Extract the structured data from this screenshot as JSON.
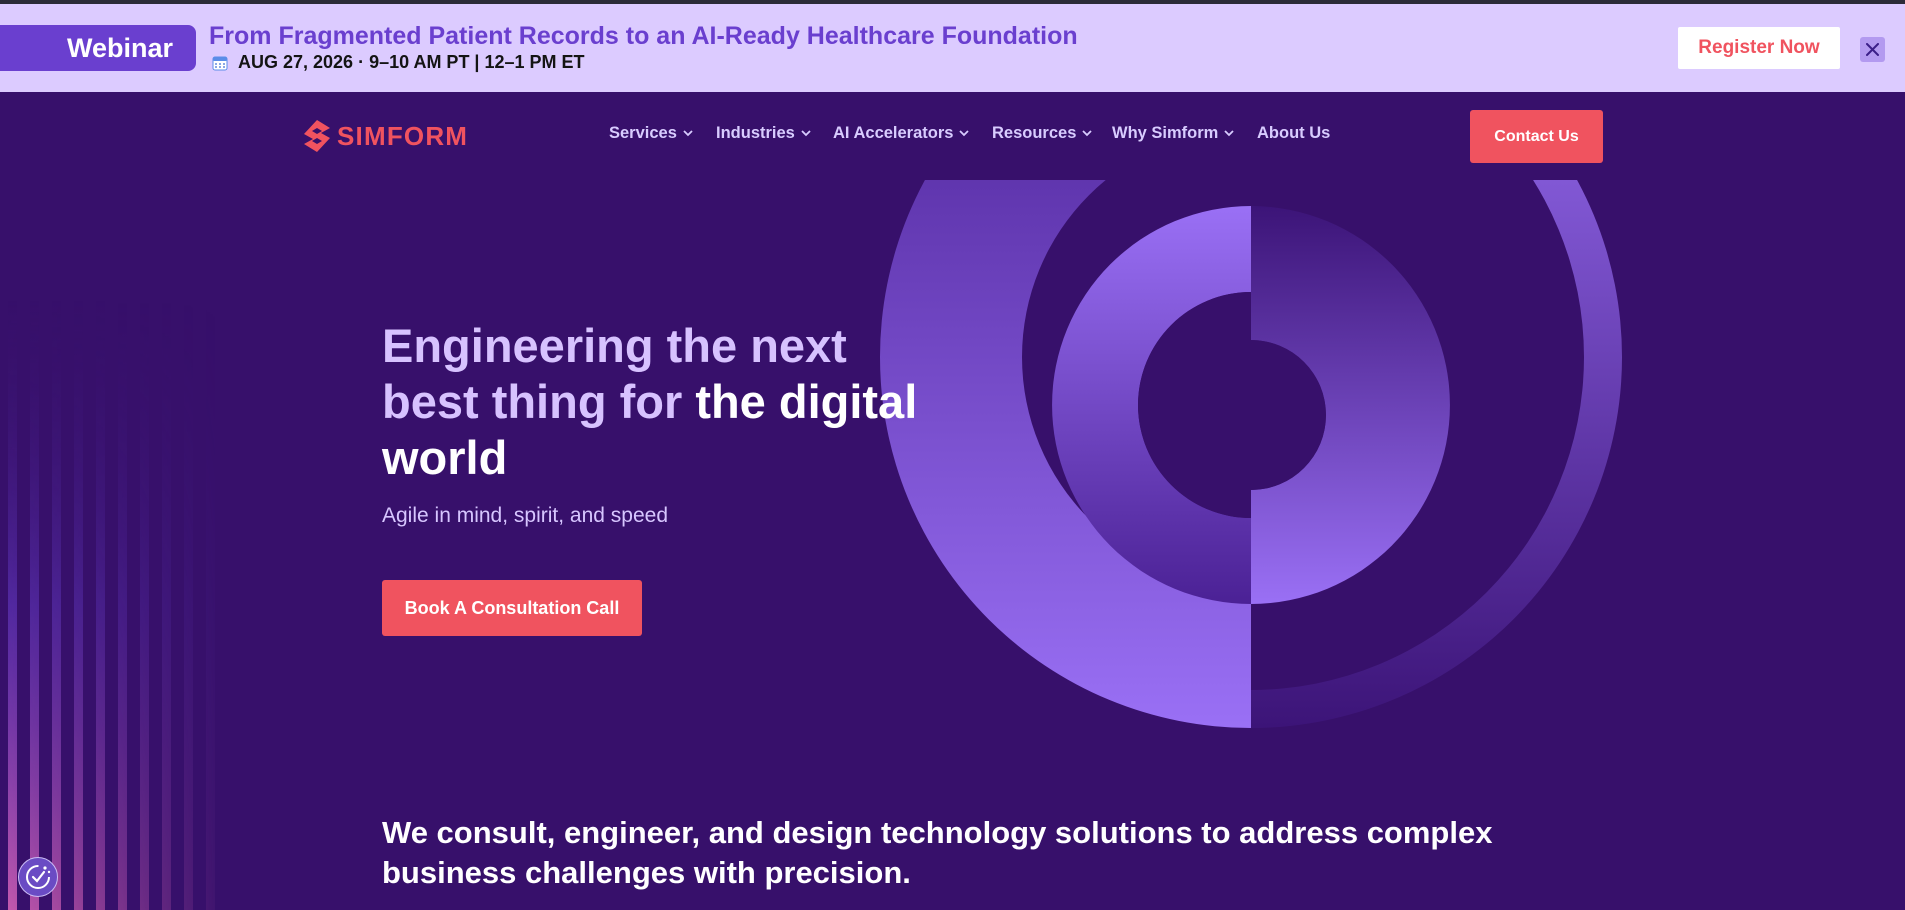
{
  "announcement": {
    "badge": "Webinar",
    "title": "From Fragmented Patient Records to an AI-Ready Healthcare Foundation",
    "date": "AUG 27, 2026 · 9–10 AM PT | 12–1 PM ET",
    "register_label": "Register Now",
    "close_icon": "close-icon",
    "calendar_icon": "calendar-icon"
  },
  "header": {
    "logo_text": "SIMFORM",
    "nav": [
      {
        "label": "Services",
        "has_dropdown": true
      },
      {
        "label": "Industries",
        "has_dropdown": true
      },
      {
        "label": "AI Accelerators",
        "has_dropdown": true
      },
      {
        "label": "Resources",
        "has_dropdown": true
      },
      {
        "label": "Why Simform",
        "has_dropdown": true
      },
      {
        "label": "About Us",
        "has_dropdown": false
      }
    ],
    "contact_label": "Contact Us"
  },
  "hero": {
    "heading_accent": "Engineering the next best thing for",
    "heading_white": "the digital world",
    "subtitle": "Agile in mind, spirit, and speed",
    "cta_label": "Book A Consultation Call"
  },
  "statement": "We consult, engineer, and design technology solutions to address complex business challenges with precision.",
  "consent_icon": "cookie-consent-icon",
  "colors": {
    "background": "#37106b",
    "banner": "#dccbff",
    "accent": "#f0535f",
    "heading_accent": "#d7c2ff",
    "purple": "#6a3fcf"
  }
}
